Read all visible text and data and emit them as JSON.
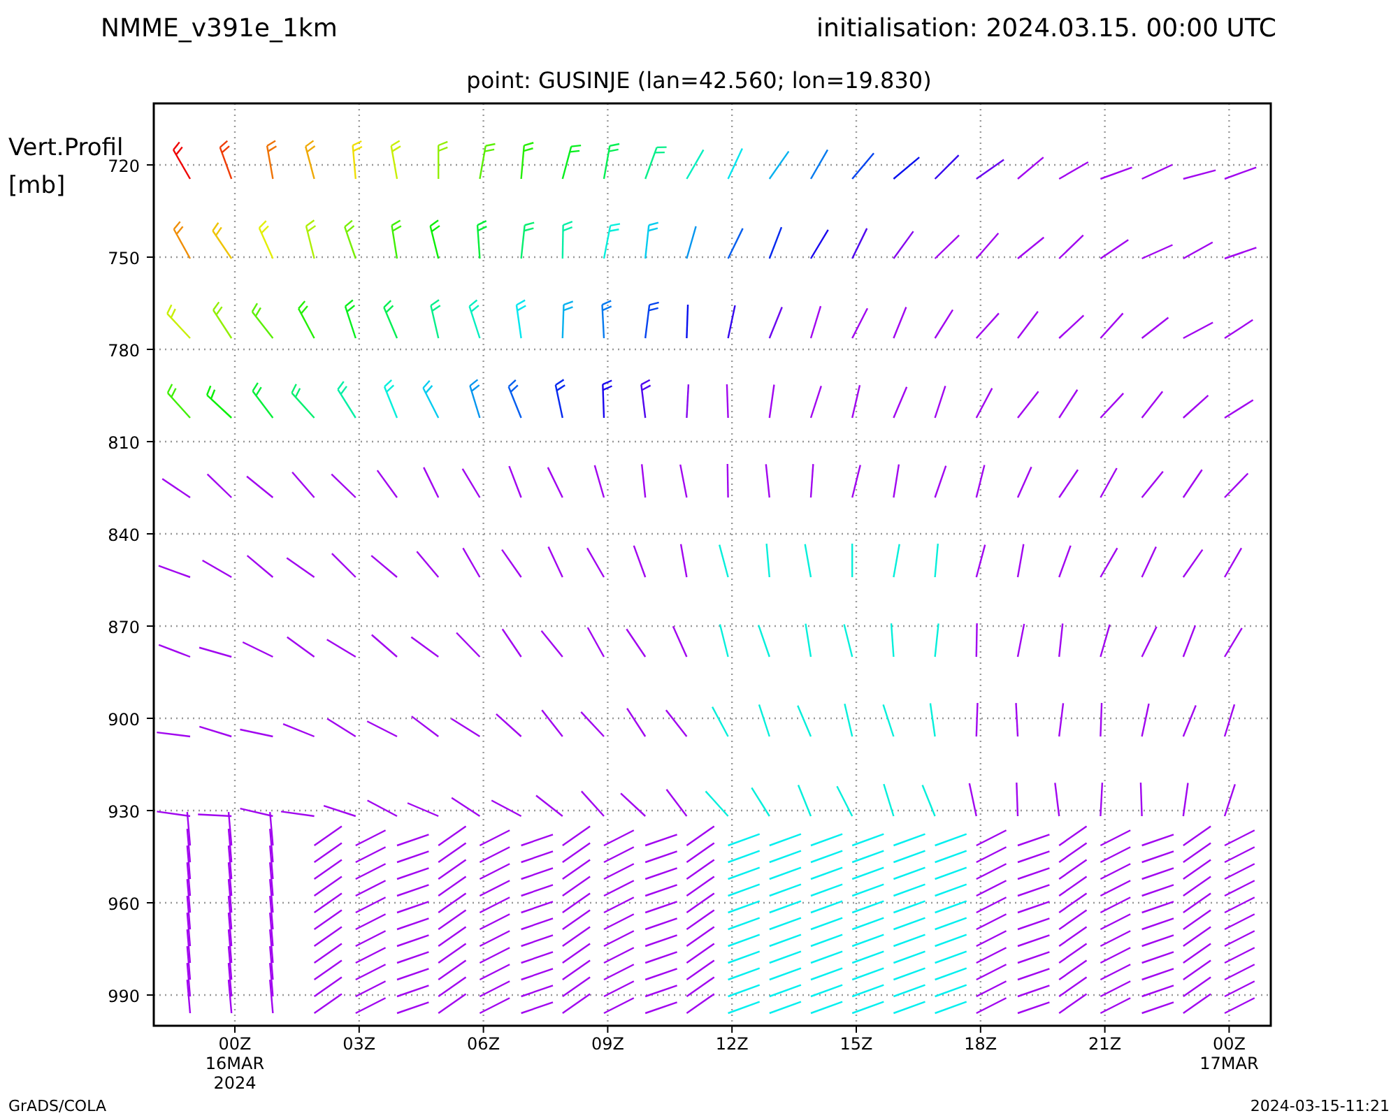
{
  "header": {
    "model": "NMME_v391e_1km",
    "initialisation": "initialisation: 2024.03.15. 00:00 UTC",
    "point": "point: GUSINJE (lan=42.560; lon=19.830)"
  },
  "y_axis": {
    "label": "Vert.Profil",
    "unit": "[mb]",
    "ticks": [
      "720",
      "750",
      "780",
      "810",
      "840",
      "870",
      "900",
      "930",
      "960",
      "990"
    ]
  },
  "x_axis": {
    "ticks": [
      {
        "label": "00Z",
        "date": "16MAR",
        "year": "2024"
      },
      {
        "label": "03Z"
      },
      {
        "label": "06Z"
      },
      {
        "label": "09Z"
      },
      {
        "label": "12Z"
      },
      {
        "label": "15Z"
      },
      {
        "label": "18Z"
      },
      {
        "label": "21Z"
      },
      {
        "label": "00Z",
        "date": "17MAR"
      }
    ]
  },
  "footer": {
    "left": "GrADS/COLA",
    "right": "2024-03-15-11:21"
  }
}
